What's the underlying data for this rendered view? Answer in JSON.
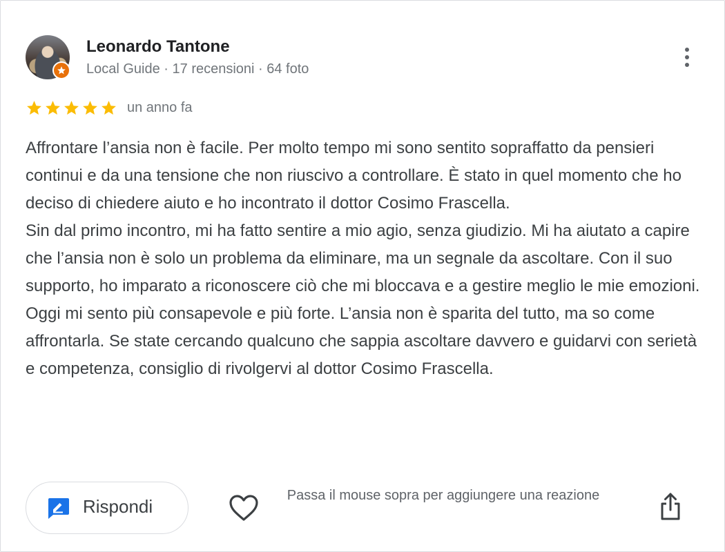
{
  "reviewer": {
    "name": "Leonardo Tantone",
    "meta": "Local Guide · 17 recensioni · 64 foto",
    "avatar_icon": "reviewer-photo",
    "badge_icon": "local-guide-star-icon",
    "badge_color": "#e8710a"
  },
  "rating": {
    "stars": 5,
    "max": 5,
    "star_color": "#fbbc04",
    "date": "un anno fa"
  },
  "review": {
    "paragraphs": [
      "Affrontare l’ansia non è facile. Per molto tempo mi sono sentito sopraffatto da pensieri continui e da una tensione che non riuscivo a controllare. È stato in quel momento che ho deciso di chiedere aiuto e ho incontrato il dottor Cosimo Frascella.",
      "Sin dal primo incontro, mi ha fatto sentire a mio agio, senza giudizio. Mi ha aiutato a capire che l’ansia non è solo un problema da eliminare, ma un segnale da ascoltare. Con il suo supporto, ho imparato a riconoscere ciò che mi bloccava e a gestire meglio le mie emozioni. Oggi mi sento più consapevole e più forte. L’ansia non è sparita del tutto, ma so come affrontarla. Se state cercando qualcuno che sappia ascoltare davvero e guidarvi con serietà e competenza, consiglio di rivolgervi al dottor Cosimo Frascella."
    ]
  },
  "actions": {
    "reply_label": "Rispondi",
    "reply_icon": "reply-edit-icon",
    "reaction_icon": "heart-icon",
    "reaction_hint": "Passa il mouse sopra per aggiungere una reazione",
    "share_icon": "share-icon",
    "more_icon": "more-vert-icon",
    "accent_color": "#1a73e8"
  }
}
